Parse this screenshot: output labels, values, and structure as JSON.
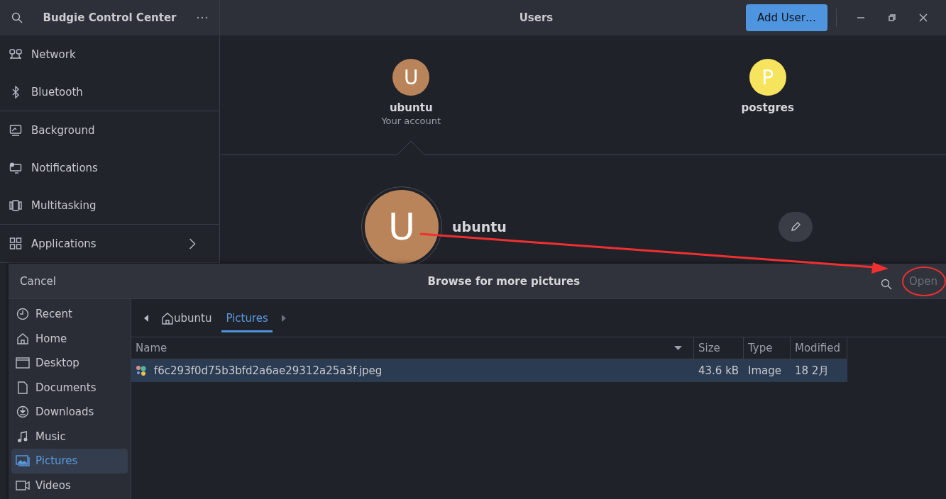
{
  "window": {
    "title": "Budgie Control Center",
    "page_title": "Users",
    "add_button": "Add User…"
  },
  "sidebar": {
    "sections": [
      {
        "items": [
          {
            "label": "Network",
            "kind": "page"
          },
          {
            "label": "Bluetooth",
            "kind": "page"
          }
        ]
      },
      {
        "items": [
          {
            "label": "Background",
            "kind": "page"
          },
          {
            "label": "Notifications",
            "kind": "page"
          },
          {
            "label": "Multitasking",
            "kind": "page"
          }
        ]
      },
      {
        "items": [
          {
            "label": "Applications",
            "kind": "submenu"
          }
        ]
      }
    ]
  },
  "users": [
    {
      "initial": "U",
      "name": "ubuntu",
      "subtitle": "Your account",
      "color": "#b9845a",
      "selected": true
    },
    {
      "initial": "P",
      "name": "postgres",
      "color": "#f6e35e",
      "selected": false
    }
  ],
  "account": {
    "initial": "U",
    "name": "ubuntu"
  },
  "dialog": {
    "title": "Browse for more pictures",
    "cancel": "Cancel",
    "open": {
      "label": "Open",
      "disabled": true
    },
    "places": [
      {
        "label": "Recent",
        "selected": false
      },
      {
        "label": "Home",
        "selected": false
      },
      {
        "label": "Desktop",
        "selected": false
      },
      {
        "label": "Documents",
        "selected": false
      },
      {
        "label": "Downloads",
        "selected": false
      },
      {
        "label": "Music",
        "selected": false
      },
      {
        "label": "Pictures",
        "selected": true
      },
      {
        "label": "Videos",
        "selected": false
      }
    ],
    "path": [
      {
        "label": "ubuntu",
        "kind": "home",
        "selected": false
      },
      {
        "label": "Pictures",
        "kind": "folder",
        "selected": true
      }
    ],
    "columns": [
      "Name",
      "Size",
      "Type",
      "Modified"
    ],
    "rows": [
      {
        "name": "f6c293f0d75b3bfd2a6ae29312a25a3f.jpeg",
        "size": "43.6 kB",
        "type": "Image",
        "modified": "18 2月",
        "selected": true
      }
    ]
  }
}
